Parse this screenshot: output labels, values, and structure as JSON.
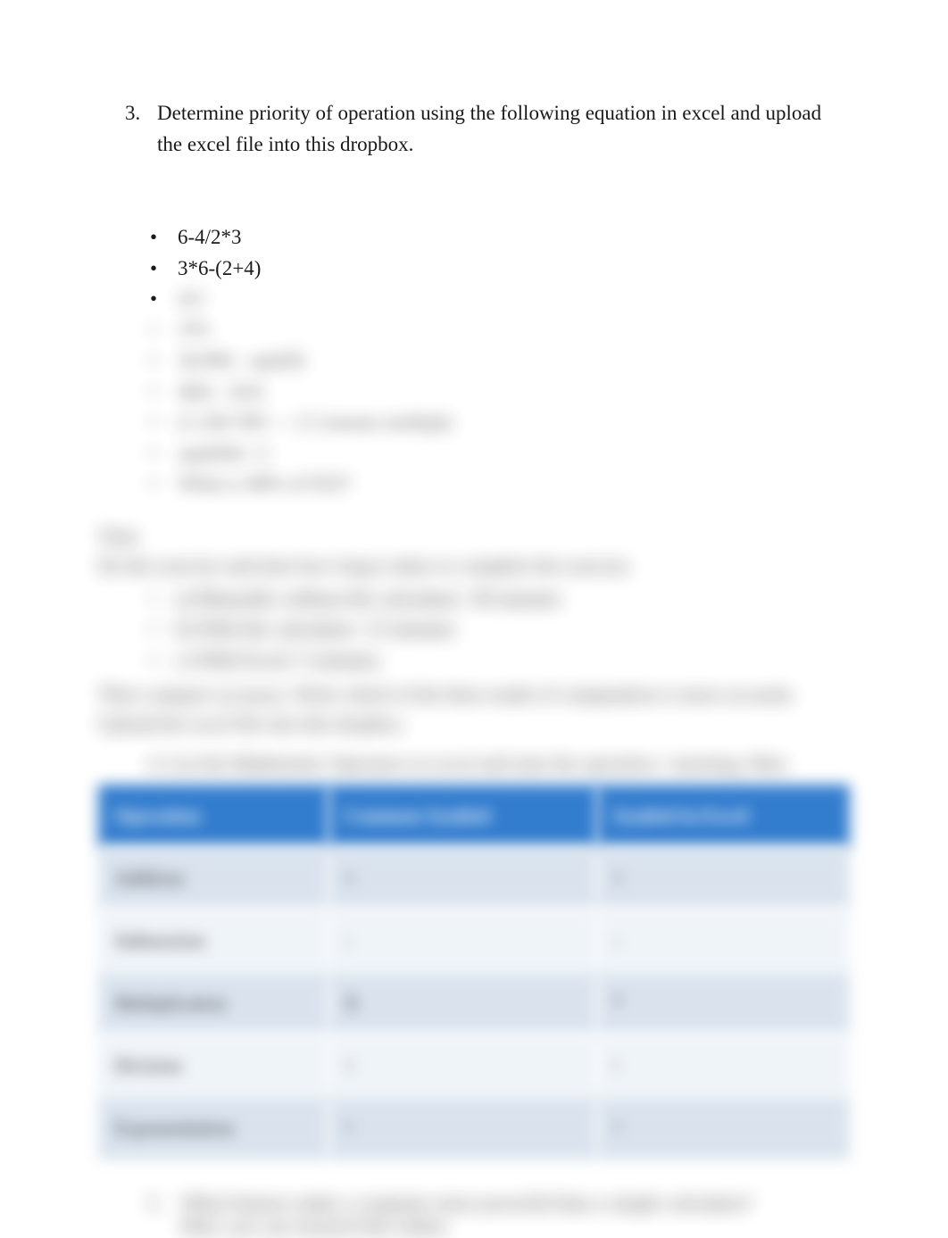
{
  "q3": {
    "number": "3.",
    "text": "Determine priority of operation using the following equation in excel and upload the excel file into this dropbox."
  },
  "bullets_clear": [
    "6-4/2*3",
    "3*6-(2+4)"
  ],
  "bullets_blurred": [
    "4/2",
    "3*6",
    "3(100) - sqrt(9)",
    "4(6) - 2(3)",
    "(1.24)^365 — (^) means multiply",
    "sqrt(64) / 2",
    "What is 48% of 923?"
  ],
  "timer": {
    "heading": "Time",
    "lead": "Do the exercise and time how long it takes to complete the exercise.",
    "items": [
      "a) Manually without the calculator: 30 minutes",
      "b) With the calculator: 13 minutes",
      "c) With Excel: 5 minutes"
    ],
    "trailing": "Then compare accuracy. Write which of the three mode of computation is more accurate. Upload the excel file into this dropbox."
  },
  "q4": {
    "number": "4.",
    "text": "List the Mathematic Operators in excel and state the operation / meaning. Hint:"
  },
  "table": {
    "headers": [
      "Operation",
      "Common Symbol",
      "Symbol in Excel"
    ],
    "rows": [
      [
        "Addition",
        "+",
        "+"
      ],
      [
        "Subtraction",
        "-",
        "-"
      ],
      [
        "Multiplication",
        "X",
        "*"
      ],
      [
        "Division",
        "÷",
        "/"
      ],
      [
        "Exponentiation",
        "^",
        "^"
      ]
    ]
  },
  "q5": {
    "number": "5.",
    "line1": "What features make a computer more powerful than a simple calculator?",
    "line2": "Hint: you can research this online."
  }
}
